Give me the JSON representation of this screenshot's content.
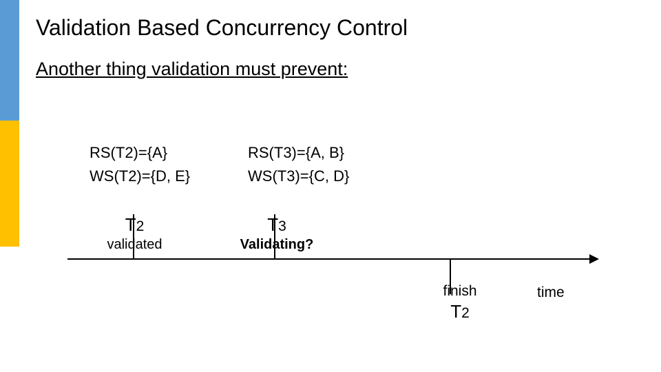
{
  "title": "Validation Based Concurrency Control",
  "subtitle": "Another thing validation must prevent:",
  "sets": {
    "t2": {
      "rs": "RS(T2)={A}",
      "ws": "WS(T2)={D, E}"
    },
    "t3": {
      "rs": "RS(T3)={A, B}",
      "ws": "WS(T3)={C, D}"
    }
  },
  "timeline": {
    "t2": {
      "name_prefix": "T",
      "name_sub": "2",
      "status": "validated"
    },
    "t3": {
      "name_prefix": "T",
      "name_sub": "3",
      "status": "Validating?"
    },
    "finish": {
      "word": "finish",
      "name_prefix": "T",
      "name_sub": "2"
    },
    "axis_label": "time"
  }
}
